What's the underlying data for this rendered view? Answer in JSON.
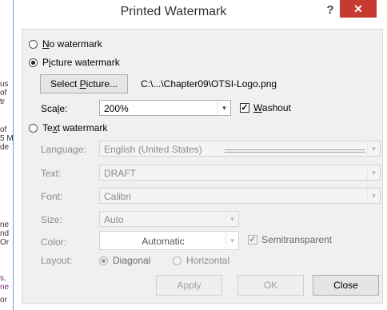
{
  "window": {
    "title": "Printed Watermark",
    "help_label": "?",
    "close_label": "✕"
  },
  "background_doc": {
    "lines": [
      "us",
      "of",
      "tr",
      "of",
      "5 M",
      "de",
      "ne",
      "nd",
      "Or",
      "s,",
      "ne",
      "or"
    ]
  },
  "options": {
    "no_watermark": {
      "pre": "",
      "key": "N",
      "post": "o watermark",
      "checked": false
    },
    "picture_watermark": {
      "pre": "P",
      "key": "i",
      "post": "cture watermark",
      "checked": true
    },
    "text_watermark": {
      "pre": "Te",
      "key": "x",
      "post": "t watermark",
      "checked": false
    }
  },
  "picture": {
    "select_button": {
      "pre": "Select ",
      "key": "P",
      "post": "icture..."
    },
    "file_path": "C:\\...\\Chapter09\\OTSI-Logo.png",
    "scale_label": {
      "pre": "Sca",
      "key": "l",
      "post": "e:"
    },
    "scale_value": "200%",
    "washout": {
      "pre": "",
      "key": "W",
      "post": "ashout",
      "checked": true
    }
  },
  "text_settings": {
    "language_label": "Language:",
    "language_value": "English (United States)",
    "text_label": "Text:",
    "text_value": "DRAFT",
    "font_label": "Font:",
    "font_value": "Calibri",
    "size_label": "Size:",
    "size_value": "Auto",
    "color_label": "Color:",
    "color_value": "Automatic",
    "semitransparent_label": "Semitransparent",
    "semitransparent_checked": true,
    "layout_label": "Layout:",
    "layout_diagonal": "Diagonal",
    "layout_horizontal": "Horizontal"
  },
  "buttons": {
    "apply": "Apply",
    "ok": "OK",
    "close": "Close"
  },
  "icons": {
    "dropdown": "▾",
    "check": "✓",
    "close": "✕"
  }
}
